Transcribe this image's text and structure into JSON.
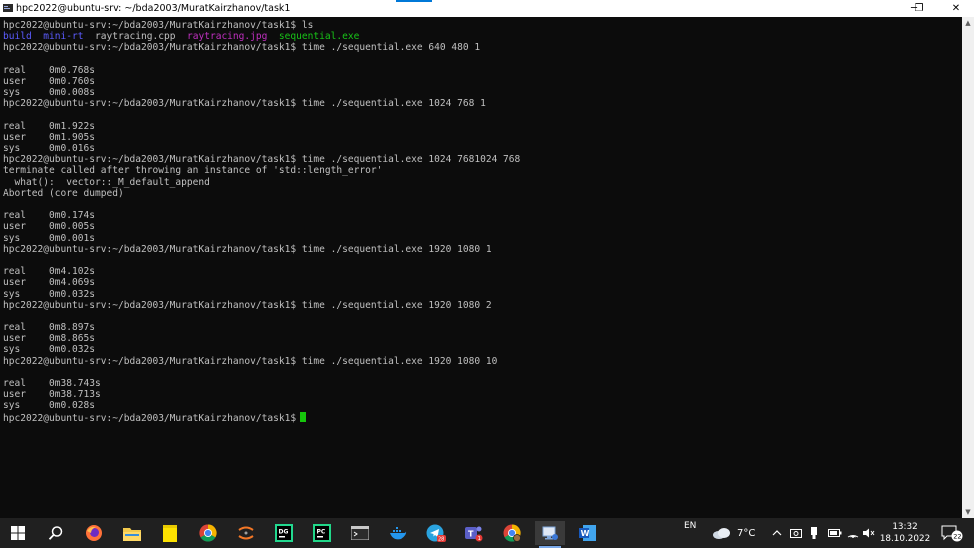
{
  "window": {
    "title": "hpc2022@ubuntu-srv: ~/bda2003/MuratKairzhanov/task1",
    "buttons": {
      "minimize": "─",
      "restore": "❐",
      "close": "✕"
    }
  },
  "terminal": {
    "prompt": "hpc2022@ubuntu-srv:~/bda2003/MuratKairzhanov/task1$",
    "cmd_ls": " ls",
    "ls": {
      "build": "build",
      "minirt": "mini-rt",
      "cpp": "raytracing.cpp",
      "jpg": "raytracing.jpg",
      "exe": "sequential.exe"
    },
    "cmd1": " time ./sequential.exe 640 480 1",
    "r1": {
      "real": "real\t0m0.768s",
      "user": "user\t0m0.760s",
      "sys": "sys\t0m0.008s"
    },
    "cmd2": " time ./sequential.exe 1024 768 1",
    "r2": {
      "real": "real\t0m1.922s",
      "user": "user\t0m1.905s",
      "sys": "sys\t0m0.016s"
    },
    "cmd3": " time ./sequential.exe 1024 7681024 768",
    "err1": "terminate called after throwing an instance of 'std::length_error'",
    "err2": "  what():  vector::_M_default_append",
    "err3": "Aborted (core dumped)",
    "r3": {
      "real": "real\t0m0.174s",
      "user": "user\t0m0.005s",
      "sys": "sys\t0m0.001s"
    },
    "cmd4": " time ./sequential.exe 1920 1080 1",
    "r4": {
      "real": "real\t0m4.102s",
      "user": "user\t0m4.069s",
      "sys": "sys\t0m0.032s"
    },
    "cmd5": " time ./sequential.exe 1920 1080 2",
    "r5": {
      "real": "real\t0m8.897s",
      "user": "user\t0m8.865s",
      "sys": "sys\t0m0.032s"
    },
    "cmd6": " time ./sequential.exe 1920 1080 10",
    "r6": {
      "real": "real\t0m38.743s",
      "user": "user\t0m38.713s",
      "sys": "sys\t0m0.028s"
    }
  },
  "taskbar": {
    "icons": [
      "windows-start-icon",
      "search-icon",
      "firefox-icon",
      "file-explorer-icon",
      "sticky-notes-icon",
      "chrome-icon",
      "jupyter-icon",
      "datagrip-icon",
      "pycharm-icon",
      "terminal-icon",
      "docker-icon",
      "telegram-icon",
      "teams-icon",
      "chrome-profile-icon",
      "remote-desktop-icon",
      "word-icon"
    ],
    "telegram_badge": "28",
    "teams_badge": "1",
    "lang": "EN",
    "temperature": "7°C",
    "time": "13:32",
    "date": "18.10.2022",
    "notification_count": "22"
  },
  "colors": {
    "terminal_bg": "#0c0c0c",
    "text": "#c0c0c0",
    "dir_blue": "#5c5cff",
    "image_magenta": "#c030c0",
    "exe_green": "#18c418",
    "taskbar": "#202020"
  }
}
